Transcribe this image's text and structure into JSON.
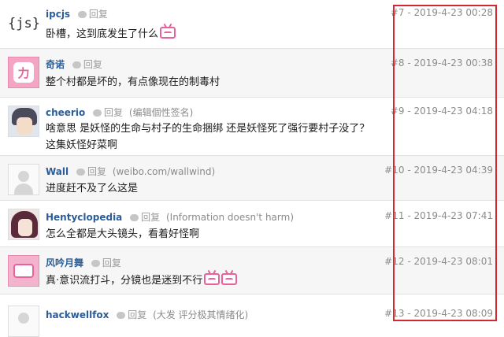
{
  "comments": [
    {
      "username": "ipcjs",
      "reply": "回复",
      "signature": "",
      "text": "卧槽，这到底发生了什么",
      "emoji_count": 1,
      "floor": "#7",
      "date": "2019-4-23",
      "time": "00:28"
    },
    {
      "username": "奇诺",
      "reply": "回复",
      "signature": "",
      "text": "整个村都是坏的，有点像现在的制毒村",
      "emoji_count": 0,
      "floor": "#8",
      "date": "2019-4-23",
      "time": "00:38"
    },
    {
      "username": "cheerio",
      "reply": "回复",
      "signature": "(编辑個性签名)",
      "text": "啥意思 是妖怪的生命与村子的生命捆绑 还是妖怪死了强行要村子没了？",
      "text2": "这集妖怪好菜啊",
      "emoji_count": 0,
      "floor": "#9",
      "date": "2019-4-23",
      "time": "04:18"
    },
    {
      "username": "Wall",
      "reply": "回复",
      "signature": "(weibo.com/wallwind)",
      "text": "进度赶不及了么这是",
      "emoji_count": 0,
      "floor": "#10",
      "date": "2019-4-23",
      "time": "04:39"
    },
    {
      "username": "Hentyclopedia",
      "reply": "回复",
      "signature": "(Information doesn't harm)",
      "text": "怎么全都是大头镜头，看着好怪啊",
      "emoji_count": 0,
      "floor": "#11",
      "date": "2019-4-23",
      "time": "07:41"
    },
    {
      "username": "风吟月舞",
      "reply": "回复",
      "signature": "",
      "text": "真·意识流打斗，分镜也是迷到不行",
      "emoji_count": 2,
      "floor": "#12",
      "date": "2019-4-23",
      "time": "08:01"
    },
    {
      "username": "hackwellfox",
      "reply": "回复",
      "signature": "(大发 评分极其情绪化)",
      "text": "",
      "emoji_count": 0,
      "floor": "#13",
      "date": "2019-4-23",
      "time": "08:09"
    }
  ],
  "avatars": [
    {
      "icon": "js-logo-icon",
      "text": "{js}"
    },
    {
      "icon": "pink-mascot-icon",
      "text": "力"
    },
    {
      "icon": "anime-boy-icon",
      "text": ""
    },
    {
      "icon": "default-avatar-icon",
      "text": ""
    },
    {
      "icon": "anime-girl-icon",
      "text": ""
    },
    {
      "icon": "tv-mascot-icon",
      "text": ""
    },
    {
      "icon": "default-avatar-icon",
      "text": ""
    }
  ],
  "colors": {
    "highlight_border": "#d6262f",
    "username": "#2a5d9a",
    "meta": "#8c8c8c"
  }
}
